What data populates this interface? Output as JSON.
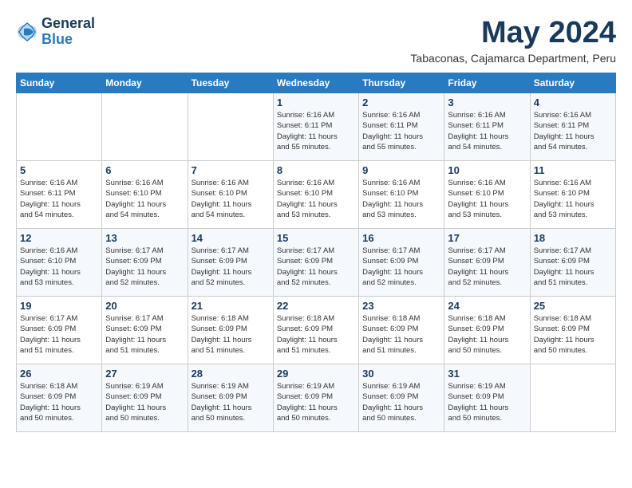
{
  "header": {
    "logo_line1": "General",
    "logo_line2": "Blue",
    "month_year": "May 2024",
    "location": "Tabaconas, Cajamarca Department, Peru"
  },
  "days_of_week": [
    "Sunday",
    "Monday",
    "Tuesday",
    "Wednesday",
    "Thursday",
    "Friday",
    "Saturday"
  ],
  "weeks": [
    [
      {
        "day": "",
        "info": ""
      },
      {
        "day": "",
        "info": ""
      },
      {
        "day": "",
        "info": ""
      },
      {
        "day": "1",
        "info": "Sunrise: 6:16 AM\nSunset: 6:11 PM\nDaylight: 11 hours\nand 55 minutes."
      },
      {
        "day": "2",
        "info": "Sunrise: 6:16 AM\nSunset: 6:11 PM\nDaylight: 11 hours\nand 55 minutes."
      },
      {
        "day": "3",
        "info": "Sunrise: 6:16 AM\nSunset: 6:11 PM\nDaylight: 11 hours\nand 54 minutes."
      },
      {
        "day": "4",
        "info": "Sunrise: 6:16 AM\nSunset: 6:11 PM\nDaylight: 11 hours\nand 54 minutes."
      }
    ],
    [
      {
        "day": "5",
        "info": "Sunrise: 6:16 AM\nSunset: 6:11 PM\nDaylight: 11 hours\nand 54 minutes."
      },
      {
        "day": "6",
        "info": "Sunrise: 6:16 AM\nSunset: 6:10 PM\nDaylight: 11 hours\nand 54 minutes."
      },
      {
        "day": "7",
        "info": "Sunrise: 6:16 AM\nSunset: 6:10 PM\nDaylight: 11 hours\nand 54 minutes."
      },
      {
        "day": "8",
        "info": "Sunrise: 6:16 AM\nSunset: 6:10 PM\nDaylight: 11 hours\nand 53 minutes."
      },
      {
        "day": "9",
        "info": "Sunrise: 6:16 AM\nSunset: 6:10 PM\nDaylight: 11 hours\nand 53 minutes."
      },
      {
        "day": "10",
        "info": "Sunrise: 6:16 AM\nSunset: 6:10 PM\nDaylight: 11 hours\nand 53 minutes."
      },
      {
        "day": "11",
        "info": "Sunrise: 6:16 AM\nSunset: 6:10 PM\nDaylight: 11 hours\nand 53 minutes."
      }
    ],
    [
      {
        "day": "12",
        "info": "Sunrise: 6:16 AM\nSunset: 6:10 PM\nDaylight: 11 hours\nand 53 minutes."
      },
      {
        "day": "13",
        "info": "Sunrise: 6:17 AM\nSunset: 6:09 PM\nDaylight: 11 hours\nand 52 minutes."
      },
      {
        "day": "14",
        "info": "Sunrise: 6:17 AM\nSunset: 6:09 PM\nDaylight: 11 hours\nand 52 minutes."
      },
      {
        "day": "15",
        "info": "Sunrise: 6:17 AM\nSunset: 6:09 PM\nDaylight: 11 hours\nand 52 minutes."
      },
      {
        "day": "16",
        "info": "Sunrise: 6:17 AM\nSunset: 6:09 PM\nDaylight: 11 hours\nand 52 minutes."
      },
      {
        "day": "17",
        "info": "Sunrise: 6:17 AM\nSunset: 6:09 PM\nDaylight: 11 hours\nand 52 minutes."
      },
      {
        "day": "18",
        "info": "Sunrise: 6:17 AM\nSunset: 6:09 PM\nDaylight: 11 hours\nand 51 minutes."
      }
    ],
    [
      {
        "day": "19",
        "info": "Sunrise: 6:17 AM\nSunset: 6:09 PM\nDaylight: 11 hours\nand 51 minutes."
      },
      {
        "day": "20",
        "info": "Sunrise: 6:17 AM\nSunset: 6:09 PM\nDaylight: 11 hours\nand 51 minutes."
      },
      {
        "day": "21",
        "info": "Sunrise: 6:18 AM\nSunset: 6:09 PM\nDaylight: 11 hours\nand 51 minutes."
      },
      {
        "day": "22",
        "info": "Sunrise: 6:18 AM\nSunset: 6:09 PM\nDaylight: 11 hours\nand 51 minutes."
      },
      {
        "day": "23",
        "info": "Sunrise: 6:18 AM\nSunset: 6:09 PM\nDaylight: 11 hours\nand 51 minutes."
      },
      {
        "day": "24",
        "info": "Sunrise: 6:18 AM\nSunset: 6:09 PM\nDaylight: 11 hours\nand 50 minutes."
      },
      {
        "day": "25",
        "info": "Sunrise: 6:18 AM\nSunset: 6:09 PM\nDaylight: 11 hours\nand 50 minutes."
      }
    ],
    [
      {
        "day": "26",
        "info": "Sunrise: 6:18 AM\nSunset: 6:09 PM\nDaylight: 11 hours\nand 50 minutes."
      },
      {
        "day": "27",
        "info": "Sunrise: 6:19 AM\nSunset: 6:09 PM\nDaylight: 11 hours\nand 50 minutes."
      },
      {
        "day": "28",
        "info": "Sunrise: 6:19 AM\nSunset: 6:09 PM\nDaylight: 11 hours\nand 50 minutes."
      },
      {
        "day": "29",
        "info": "Sunrise: 6:19 AM\nSunset: 6:09 PM\nDaylight: 11 hours\nand 50 minutes."
      },
      {
        "day": "30",
        "info": "Sunrise: 6:19 AM\nSunset: 6:09 PM\nDaylight: 11 hours\nand 50 minutes."
      },
      {
        "day": "31",
        "info": "Sunrise: 6:19 AM\nSunset: 6:09 PM\nDaylight: 11 hours\nand 50 minutes."
      },
      {
        "day": "",
        "info": ""
      }
    ]
  ]
}
